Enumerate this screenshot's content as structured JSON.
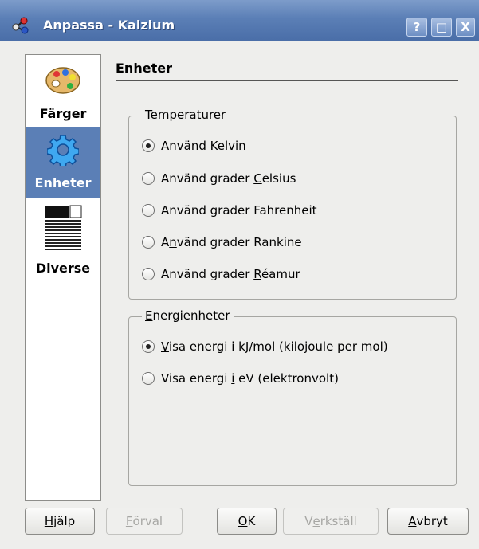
{
  "window": {
    "title": "Anpassa - Kalzium",
    "help_button": "?",
    "maximize_button": "□",
    "close_button": "X"
  },
  "sidebar": {
    "items": [
      {
        "label": "Färger",
        "icon": "palette-icon",
        "selected": false
      },
      {
        "label": "Enheter",
        "icon": "gear-icon",
        "selected": true
      },
      {
        "label": "Diverse",
        "icon": "document-lines-icon",
        "selected": false
      }
    ]
  },
  "page": {
    "title": "Enheter"
  },
  "temperatures": {
    "title_ul": "T",
    "title_rest": "emperaturer",
    "options": [
      {
        "pre": "Använd ",
        "ul": "K",
        "post": "elvin",
        "checked": true
      },
      {
        "pre": "Använd grader ",
        "ul": "C",
        "post": "elsius",
        "checked": false
      },
      {
        "pre": "Använd ",
        "ul": "g",
        "post": "rader Fahrenheit",
        "checked": false
      },
      {
        "pre": "A",
        "ul": "n",
        "post": "vänd grader Rankine",
        "checked": false
      },
      {
        "pre": "Använd grader ",
        "ul": "R",
        "post": "éamur",
        "checked": false
      }
    ]
  },
  "energy": {
    "title_ul": "E",
    "title_rest": "nergienheter",
    "options": [
      {
        "pre": "",
        "ul": "V",
        "post": "isa energi i kJ/mol (kilojoule per mol)",
        "checked": true
      },
      {
        "pre": "Visa energi ",
        "ul": "i",
        "post": " eV (elektronvolt)",
        "checked": false
      }
    ]
  },
  "buttons": {
    "help": {
      "ul": "H",
      "rest": "jälp"
    },
    "defaults": {
      "ul": "F",
      "rest": "örval"
    },
    "ok": {
      "ul": "O",
      "rest": "K"
    },
    "apply": {
      "pre": "V",
      "ul": "e",
      "rest": "rkställ"
    },
    "cancel": {
      "ul": "A",
      "rest": "vbryt"
    }
  },
  "colors": {
    "titlebar": "#5b7fb6",
    "selection": "#5b7fb6",
    "window_bg": "#eeeeec"
  }
}
